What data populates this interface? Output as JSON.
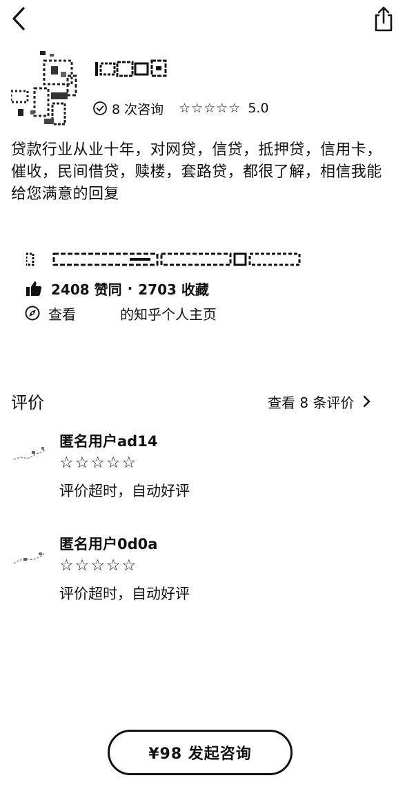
{
  "header": {
    "back_icon": "chevron-left-icon",
    "share_icon": "share-icon"
  },
  "profile": {
    "consult_count": "8 次咨询",
    "stars": "☆☆☆☆☆",
    "rating": "5.0",
    "bio": "贷款行业从业十年，对网贷，信贷，抵押贷，信用卡，催收，民间借贷，赎楼，套路贷，都很了解，相信我能给您满意的回复",
    "likes": "2408 赞同",
    "separator": "·",
    "favorites": "2703 收藏",
    "profile_link_prefix": "查看",
    "profile_link_suffix": "的知乎个人主页"
  },
  "reviews_section": {
    "title": "评价",
    "see_all": "查看 8 条评价",
    "items": [
      {
        "name": "匿名用户ad14",
        "stars": "☆☆☆☆☆",
        "text": "评价超时，自动好评"
      },
      {
        "name": "匿名用户0d0a",
        "stars": "☆☆☆☆☆",
        "text": "评价超时，自动好评"
      }
    ]
  },
  "cta": {
    "label": "¥98 发起咨询"
  }
}
